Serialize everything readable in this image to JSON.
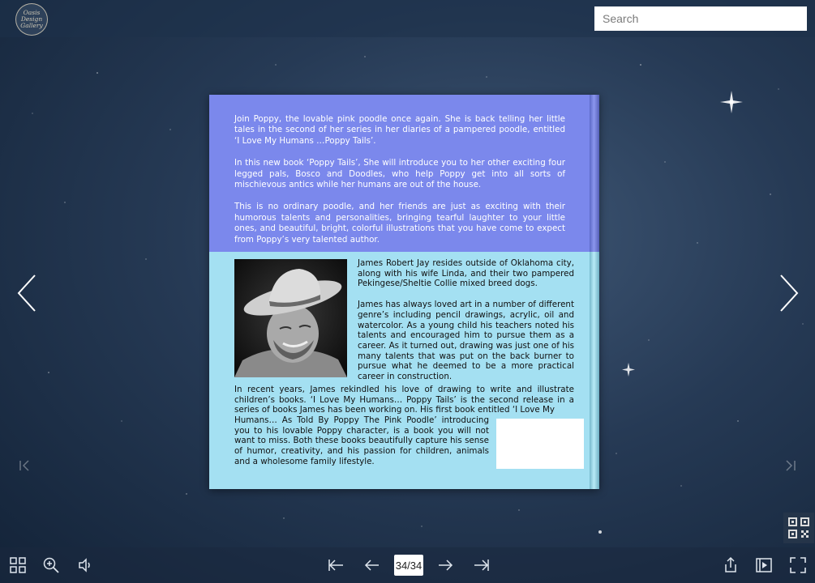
{
  "header": {
    "logo_lines": [
      "Oasis",
      "Design",
      "Gallery"
    ],
    "search_placeholder": "Search"
  },
  "book_page": {
    "top_paragraphs": [
      "Join Poppy, the lovable pink poodle once again. She is back telling her little tales in the second of her series in her diaries of a pampered poodle, entitled ‘I Love My Humans …Poppy Tails’.",
      "In this new book ‘Poppy Tails’, She will introduce you to her other exciting four legged pals, Bosco and Doodles, who help Poppy get into all sorts of mischievous antics while her humans are out of the house.",
      "This is no ordinary poodle, and her friends are just as exciting with their humorous talents and personalities, bringing tearful laughter to your little ones, and beautiful, bright, colorful illustrations that you have come to expect from Poppy’s very talented author."
    ],
    "bio_paragraphs": [
      "James Robert Jay resides outside of Oklahoma city, along with his wife Linda, and their two pampered Pekingese/Sheltie Collie mixed breed dogs.",
      "James has always loved art in a number of different genre’s including pencil drawings, acrylic, oil and watercolor. As a young child his teachers noted his talents and encouraged him to pursue them as a career. As it turned out, drawing was just one of his many talents that was put on the back burner to pursue what he deemed to be a more practical career in construction.",
      "In recent years, James rekindled his love of drawing to write and illustrate children’s books. ‘I Love My Humans… Poppy Tails’ is the second release in a series of books James has been working on. His first book entitled ‘I Love My",
      "Humans… As Told By Poppy The Pink Poodle’ introducing you to his lovable Poppy character, is a book you will not want to miss. Both these books beautifully capture his sense of humor, creativity, and his passion for children, animals and a wholesome family lifestyle."
    ]
  },
  "toolbar": {
    "page_indicator": "34/34"
  },
  "colors": {
    "top_panel": "#7b88ec",
    "bottom_panel": "#a4e0f2"
  }
}
